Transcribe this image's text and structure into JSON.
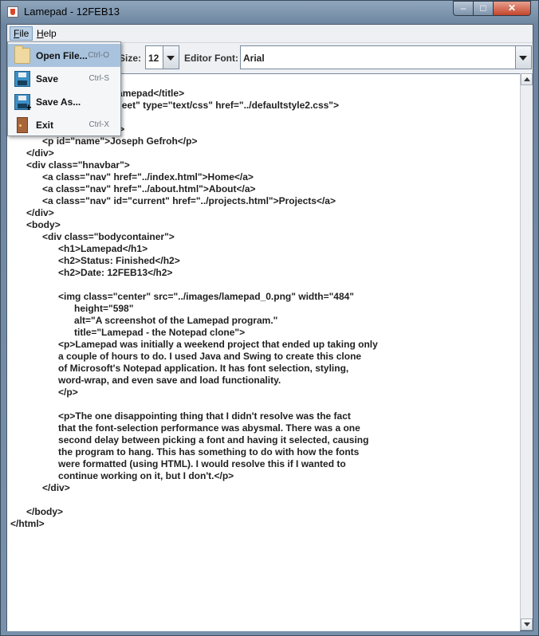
{
  "window": {
    "title": "Lamepad - 12FEB13",
    "min_glyph": "–",
    "max_glyph": "□",
    "close_glyph": "✕"
  },
  "menubar": {
    "file": {
      "prefix": "F",
      "rest": "ile"
    },
    "help": {
      "prefix": "H",
      "rest": "elp"
    }
  },
  "file_menu": {
    "items": [
      {
        "label": "Open File...",
        "shortcut": "Ctrl-O",
        "icon": "folder-icon"
      },
      {
        "label": "Save",
        "shortcut": "Ctrl-S",
        "icon": "save-disk-icon"
      },
      {
        "label": "Save As...",
        "shortcut": "",
        "icon": "save-as-disk-icon"
      },
      {
        "label": "Exit",
        "shortcut": "Ctrl-X",
        "icon": "exit-door-icon"
      }
    ]
  },
  "toolbar": {
    "size_label": "Size:",
    "size_value": "12",
    "font_label": "Editor Font:",
    "font_value": "Arial"
  },
  "editor": {
    "text": "\t\t<head>\n\t\t<title>Project - Lamepad</title>\n\t\t<link rel=\"stylesheet\" type=\"text/css\" href=\"../defaultstyle2.css\">\n\n\t<div class=\"banner\">\n\t\t<p id=\"name\">Joseph Gefroh</p>\n\t</div>\n\t<div class=\"hnavbar\">\n\t\t<a class=\"nav\" href=\"../index.html\">Home</a>\n\t\t<a class=\"nav\" href=\"../about.html\">About</a>\n\t\t<a class=\"nav\" id=\"current\" href=\"../projects.html\">Projects</a>\n\t</div>\n\t<body>\n\t\t<div class=\"bodycontainer\">\n\t\t\t<h1>Lamepad</h1>\n\t\t\t<h2>Status: Finished</h2>\n\t\t\t<h2>Date: 12FEB13</h2>\n\n\t\t\t<img class=\"center\" src=\"../images/lamepad_0.png\" width=\"484\"\n\t\t\t\theight=\"598\"\n\t\t\t\talt=\"A screenshot of the Lamepad program.\"\n\t\t\t\ttitle=\"Lamepad - the Notepad clone\">\n\t\t\t<p>Lamepad was initially a weekend project that ended up taking only\n\t\t\ta couple of hours to do. I used Java and Swing to create this clone\n\t\t\tof Microsoft's Notepad application. It has font selection, styling,\n\t\t\tword-wrap, and even save and load functionality.\n\t\t\t</p>\n\n\t\t\t<p>The one disappointing thing that I didn't resolve was the fact\n\t\t\tthat the font-selection performance was abysmal. There was a one\n\t\t\tsecond delay between picking a font and having it selected, causing\n\t\t\tthe program to hang. This has something to do with how the fonts\n\t\t\twere formatted (using HTML). I would resolve this if I wanted to\n\t\t\tcontinue working on it, but I don't.</p>\n\t\t</div>\n\n\t</body>\n</html>"
  },
  "colors": {
    "menu_highlight": "#a9c3de",
    "title_bar": "#8fa6bd",
    "close_button": "#c4452c"
  }
}
